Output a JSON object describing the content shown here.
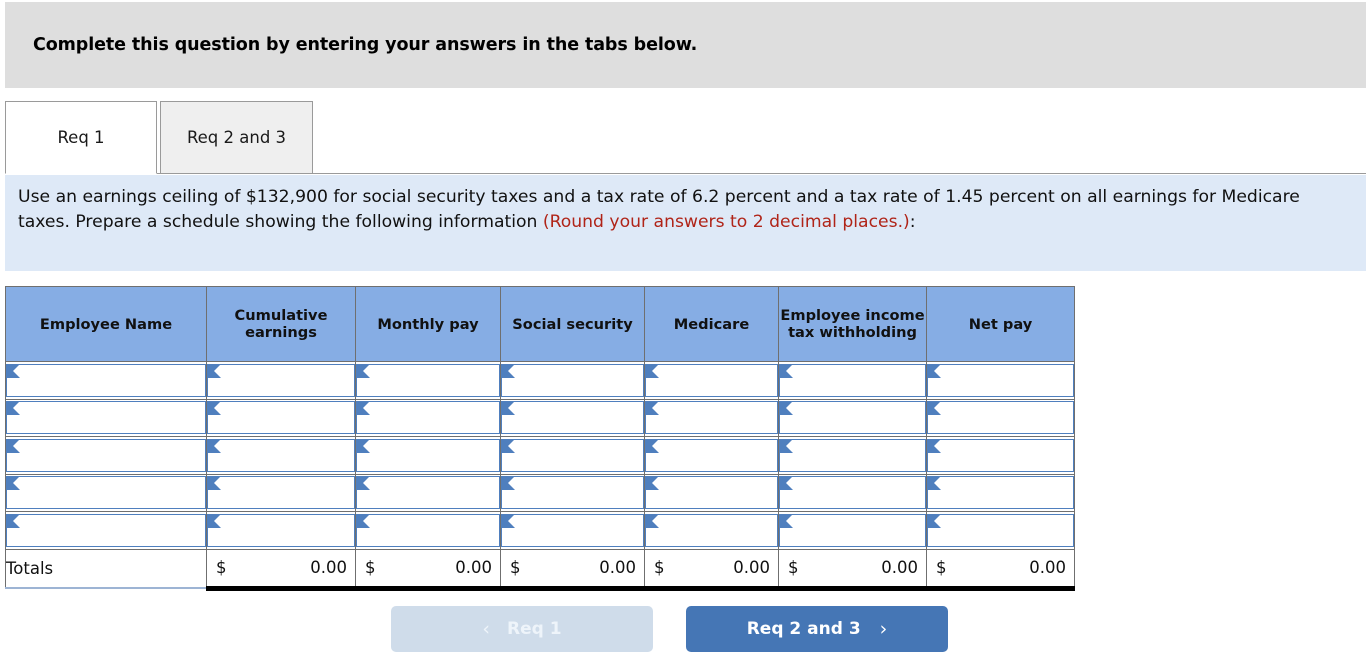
{
  "banner": {
    "text": "Complete this question by entering your answers in the tabs below."
  },
  "tabs": [
    {
      "label": "Req 1",
      "active": true
    },
    {
      "label": "Req 2 and 3",
      "active": false
    }
  ],
  "instruction": {
    "part1": "Use an earnings ceiling of $132,900 for social security taxes and a tax rate of 6.2 percent and a tax rate of 1.45 percent on all earnings for Medicare taxes. Prepare a schedule showing the following information ",
    "highlight": "(Round your answers to 2 decimal places.)",
    "part2": ":"
  },
  "table": {
    "headers": [
      "Employee Name",
      "Cumulative earnings",
      "Monthly pay",
      "Social security",
      "Medicare",
      "Employee income tax withholding",
      "Net pay"
    ],
    "input_rows": 5,
    "input_values": [
      [
        "",
        "",
        "",
        "",
        "",
        "",
        ""
      ],
      [
        "",
        "",
        "",
        "",
        "",
        "",
        ""
      ],
      [
        "",
        "",
        "",
        "",
        "",
        "",
        ""
      ],
      [
        "",
        "",
        "",
        "",
        "",
        "",
        ""
      ],
      [
        "",
        "",
        "",
        "",
        "",
        "",
        ""
      ]
    ],
    "totals": {
      "label": "Totals",
      "currency": "$",
      "values": [
        "0.00",
        "0.00",
        "0.00",
        "0.00",
        "0.00",
        "0.00"
      ]
    }
  },
  "nav": {
    "prev_label": "Req 1",
    "prev_icon": "chevron-left-icon",
    "prev_glyph": "‹",
    "prev_disabled": true,
    "next_label": "Req 2 and 3",
    "next_icon": "chevron-right-icon",
    "next_glyph": "›"
  },
  "colors": {
    "banner_bg": "#dedede",
    "instruction_bg": "#dee9f7",
    "header_blue": "#86ade4",
    "accent_blue": "#4576b5",
    "input_border": "#4f7fbe",
    "red_text": "#b02418",
    "disabled_btn": "#cfdcea"
  }
}
